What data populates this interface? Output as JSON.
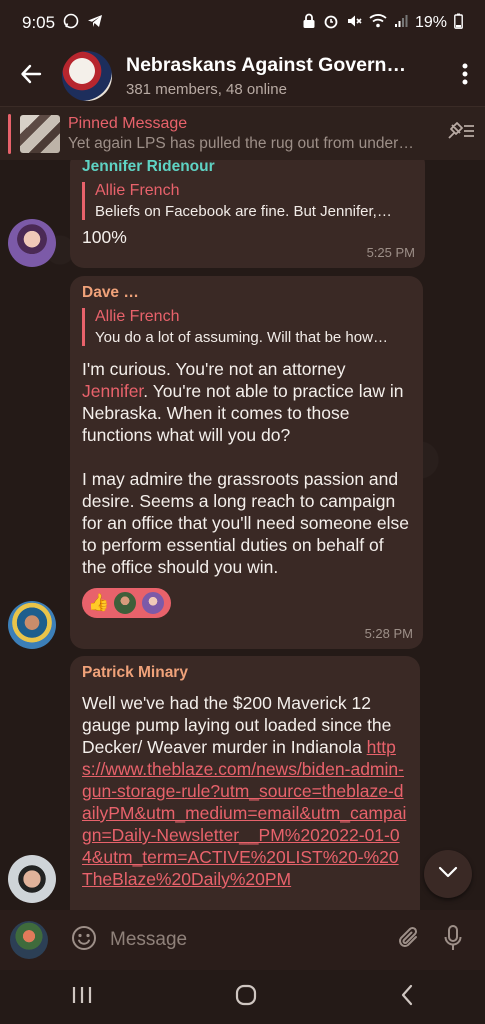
{
  "status_bar": {
    "time": "9:05",
    "battery": "19%",
    "icons": [
      "whatsapp-icon",
      "telegram-icon",
      "lock-icon",
      "alarm-icon",
      "mute-icon",
      "wifi-icon",
      "signal-icon",
      "battery-icon"
    ]
  },
  "header": {
    "title": "Nebraskans Against Govern…",
    "subtitle": "381 members, 48 online"
  },
  "pinned": {
    "title": "Pinned Message",
    "preview": "Yet again LPS has pulled the rug out from under…"
  },
  "messages": [
    {
      "sender": "Jennifer Ridenour",
      "sender_color": "#5fd3c4",
      "reply_name": "Allie French",
      "reply_text": "Beliefs on Facebook are fine. But Jennifer,…",
      "text": "100%",
      "time": "5:25 PM"
    },
    {
      "sender": "Dave …",
      "sender_color": "#f0a27a",
      "reply_name": "Allie French",
      "reply_text": "You do a lot of assuming. Will that be how…",
      "text_before": "I'm curious. You're not an attorney ",
      "mention": "Jennifer",
      "text_after": ". You're not able to practice law in Nebraska. When it comes to those functions what will you do?",
      "paragraph2": "I may admire the grassroots passion and desire. Seems a long reach to campaign for an office that you'll need someone else to perform essential duties on behalf of the office should you win.",
      "reaction_emoji": "👍",
      "time": "5:28 PM"
    },
    {
      "sender": "Patrick Minary",
      "sender_color": "#f0a27a",
      "text": "Well we've had the $200 Maverick 12 gauge pump laying out loaded since the Decker/ Weaver murder in Indianola ",
      "link": "https://www.theblaze.com/news/biden-admin-gun-storage-rule?utm_source=theblaze-dailyPM&utm_medium=email&utm_campaign=Daily-Newsletter__PM%202022-01-04&utm_term=ACTIVE%20LIST%20-%20TheBlaze%20Daily%20PM"
    }
  ],
  "composer": {
    "placeholder": "Message"
  },
  "colors": {
    "accent": "#e8626b",
    "bubble": "#3a2925",
    "background": "#241a17"
  }
}
